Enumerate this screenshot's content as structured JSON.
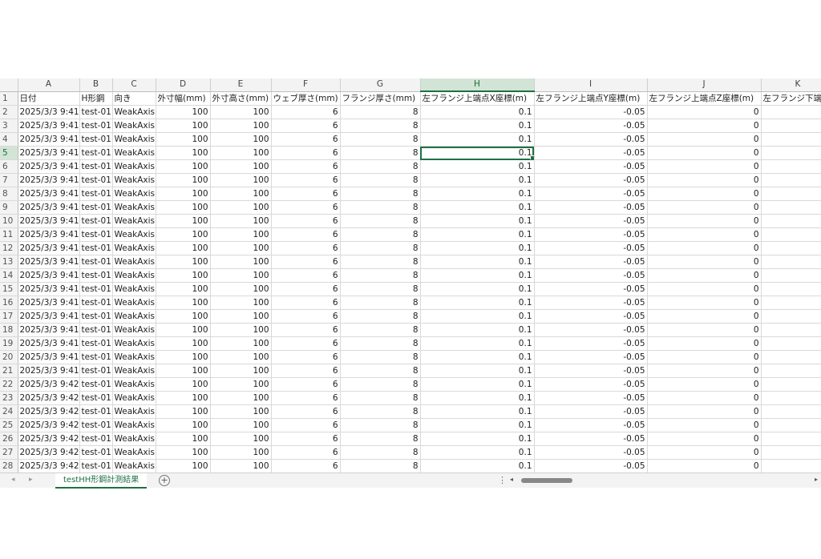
{
  "columns": [
    "A",
    "B",
    "C",
    "D",
    "E",
    "F",
    "G",
    "H",
    "I",
    "J",
    "K"
  ],
  "active_column": "H",
  "active_row": "5",
  "headers": [
    "日付",
    "H形鋼",
    "向き",
    "外寸幅(mm)",
    "外寸高さ(mm)",
    "ウェブ厚さ(mm)",
    "フランジ厚さ(mm)",
    "左フランジ上端点X座標(m)",
    "左フランジ上端点Y座標(m)",
    "左フランジ上端点Z座標(m)",
    "左フランジ下端"
  ],
  "rows": [
    {
      "n": "2",
      "date": "2025/3/3 9:41",
      "id": "test-01",
      "dir": "WeakAxis",
      "w": "100",
      "h": "100",
      "web": "6",
      "fl": "8",
      "x": "0.1",
      "y": "-0.05",
      "z": "0"
    },
    {
      "n": "3",
      "date": "2025/3/3 9:41",
      "id": "test-01",
      "dir": "WeakAxis",
      "w": "100",
      "h": "100",
      "web": "6",
      "fl": "8",
      "x": "0.1",
      "y": "-0.05",
      "z": "0"
    },
    {
      "n": "4",
      "date": "2025/3/3 9:41",
      "id": "test-01",
      "dir": "WeakAxis",
      "w": "100",
      "h": "100",
      "web": "6",
      "fl": "8",
      "x": "0.1",
      "y": "-0.05",
      "z": "0"
    },
    {
      "n": "5",
      "date": "2025/3/3 9:41",
      "id": "test-01",
      "dir": "WeakAxis",
      "w": "100",
      "h": "100",
      "web": "6",
      "fl": "8",
      "x": "0.1",
      "y": "-0.05",
      "z": "0"
    },
    {
      "n": "6",
      "date": "2025/3/3 9:41",
      "id": "test-01",
      "dir": "WeakAxis",
      "w": "100",
      "h": "100",
      "web": "6",
      "fl": "8",
      "x": "0.1",
      "y": "-0.05",
      "z": "0"
    },
    {
      "n": "7",
      "date": "2025/3/3 9:41",
      "id": "test-01",
      "dir": "WeakAxis",
      "w": "100",
      "h": "100",
      "web": "6",
      "fl": "8",
      "x": "0.1",
      "y": "-0.05",
      "z": "0"
    },
    {
      "n": "8",
      "date": "2025/3/3 9:41",
      "id": "test-01",
      "dir": "WeakAxis",
      "w": "100",
      "h": "100",
      "web": "6",
      "fl": "8",
      "x": "0.1",
      "y": "-0.05",
      "z": "0"
    },
    {
      "n": "9",
      "date": "2025/3/3 9:41",
      "id": "test-01",
      "dir": "WeakAxis",
      "w": "100",
      "h": "100",
      "web": "6",
      "fl": "8",
      "x": "0.1",
      "y": "-0.05",
      "z": "0"
    },
    {
      "n": "10",
      "date": "2025/3/3 9:41",
      "id": "test-01",
      "dir": "WeakAxis",
      "w": "100",
      "h": "100",
      "web": "6",
      "fl": "8",
      "x": "0.1",
      "y": "-0.05",
      "z": "0"
    },
    {
      "n": "11",
      "date": "2025/3/3 9:41",
      "id": "test-01",
      "dir": "WeakAxis",
      "w": "100",
      "h": "100",
      "web": "6",
      "fl": "8",
      "x": "0.1",
      "y": "-0.05",
      "z": "0"
    },
    {
      "n": "12",
      "date": "2025/3/3 9:41",
      "id": "test-01",
      "dir": "WeakAxis",
      "w": "100",
      "h": "100",
      "web": "6",
      "fl": "8",
      "x": "0.1",
      "y": "-0.05",
      "z": "0"
    },
    {
      "n": "13",
      "date": "2025/3/3 9:41",
      "id": "test-01",
      "dir": "WeakAxis",
      "w": "100",
      "h": "100",
      "web": "6",
      "fl": "8",
      "x": "0.1",
      "y": "-0.05",
      "z": "0"
    },
    {
      "n": "14",
      "date": "2025/3/3 9:41",
      "id": "test-01",
      "dir": "WeakAxis",
      "w": "100",
      "h": "100",
      "web": "6",
      "fl": "8",
      "x": "0.1",
      "y": "-0.05",
      "z": "0"
    },
    {
      "n": "15",
      "date": "2025/3/3 9:41",
      "id": "test-01",
      "dir": "WeakAxis",
      "w": "100",
      "h": "100",
      "web": "6",
      "fl": "8",
      "x": "0.1",
      "y": "-0.05",
      "z": "0"
    },
    {
      "n": "16",
      "date": "2025/3/3 9:41",
      "id": "test-01",
      "dir": "WeakAxis",
      "w": "100",
      "h": "100",
      "web": "6",
      "fl": "8",
      "x": "0.1",
      "y": "-0.05",
      "z": "0"
    },
    {
      "n": "17",
      "date": "2025/3/3 9:41",
      "id": "test-01",
      "dir": "WeakAxis",
      "w": "100",
      "h": "100",
      "web": "6",
      "fl": "8",
      "x": "0.1",
      "y": "-0.05",
      "z": "0"
    },
    {
      "n": "18",
      "date": "2025/3/3 9:41",
      "id": "test-01",
      "dir": "WeakAxis",
      "w": "100",
      "h": "100",
      "web": "6",
      "fl": "8",
      "x": "0.1",
      "y": "-0.05",
      "z": "0"
    },
    {
      "n": "19",
      "date": "2025/3/3 9:41",
      "id": "test-01",
      "dir": "WeakAxis",
      "w": "100",
      "h": "100",
      "web": "6",
      "fl": "8",
      "x": "0.1",
      "y": "-0.05",
      "z": "0"
    },
    {
      "n": "20",
      "date": "2025/3/3 9:41",
      "id": "test-01",
      "dir": "WeakAxis",
      "w": "100",
      "h": "100",
      "web": "6",
      "fl": "8",
      "x": "0.1",
      "y": "-0.05",
      "z": "0"
    },
    {
      "n": "21",
      "date": "2025/3/3 9:41",
      "id": "test-01",
      "dir": "WeakAxis",
      "w": "100",
      "h": "100",
      "web": "6",
      "fl": "8",
      "x": "0.1",
      "y": "-0.05",
      "z": "0"
    },
    {
      "n": "22",
      "date": "2025/3/3 9:42",
      "id": "test-01",
      "dir": "WeakAxis",
      "w": "100",
      "h": "100",
      "web": "6",
      "fl": "8",
      "x": "0.1",
      "y": "-0.05",
      "z": "0"
    },
    {
      "n": "23",
      "date": "2025/3/3 9:42",
      "id": "test-01",
      "dir": "WeakAxis",
      "w": "100",
      "h": "100",
      "web": "6",
      "fl": "8",
      "x": "0.1",
      "y": "-0.05",
      "z": "0"
    },
    {
      "n": "24",
      "date": "2025/3/3 9:42",
      "id": "test-01",
      "dir": "WeakAxis",
      "w": "100",
      "h": "100",
      "web": "6",
      "fl": "8",
      "x": "0.1",
      "y": "-0.05",
      "z": "0"
    },
    {
      "n": "25",
      "date": "2025/3/3 9:42",
      "id": "test-01",
      "dir": "WeakAxis",
      "w": "100",
      "h": "100",
      "web": "6",
      "fl": "8",
      "x": "0.1",
      "y": "-0.05",
      "z": "0"
    },
    {
      "n": "26",
      "date": "2025/3/3 9:42",
      "id": "test-01",
      "dir": "WeakAxis",
      "w": "100",
      "h": "100",
      "web": "6",
      "fl": "8",
      "x": "0.1",
      "y": "-0.05",
      "z": "0"
    },
    {
      "n": "27",
      "date": "2025/3/3 9:42",
      "id": "test-01",
      "dir": "WeakAxis",
      "w": "100",
      "h": "100",
      "web": "6",
      "fl": "8",
      "x": "0.1",
      "y": "-0.05",
      "z": "0"
    },
    {
      "n": "28",
      "date": "2025/3/3 9:42",
      "id": "test-01",
      "dir": "WeakAxis",
      "w": "100",
      "h": "100",
      "web": "6",
      "fl": "8",
      "x": "0.1",
      "y": "-0.05",
      "z": "0"
    }
  ],
  "sheet_tab": {
    "label": "testHH形鋼計測結果"
  },
  "footer": {
    "add_sheet": "+",
    "more": "⋮",
    "nav_prev": "◂",
    "nav_next": "▸",
    "scroll_left": "◂",
    "scroll_right": "▸"
  },
  "colors": {
    "accent": "#1e7145",
    "header_bg": "#f3f3f3",
    "active_header_bg": "#d2e4d6"
  }
}
